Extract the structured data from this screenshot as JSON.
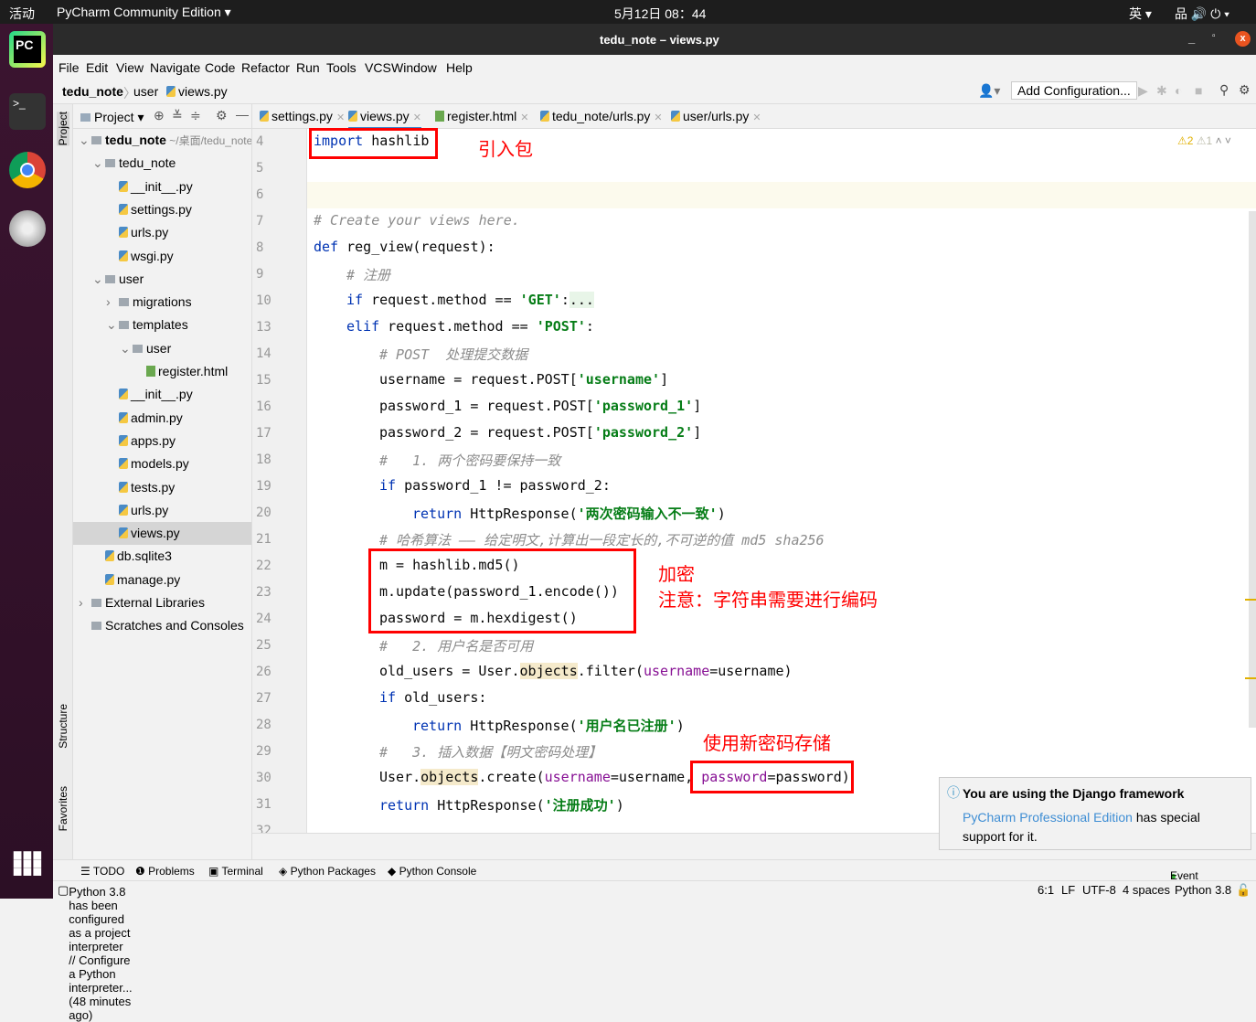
{
  "topbar": {
    "activities": "活动",
    "app": "PyCharm Community Edition ▾",
    "clock": "5月12日 08：44",
    "ime": "英 ▾",
    "tray": "品 🔊 ⏻ ▾"
  },
  "window": {
    "title": "tedu_note – views.py"
  },
  "menu": [
    "File",
    "Edit",
    "View",
    "Navigate",
    "Code",
    "Refactor",
    "Run",
    "Tools",
    "VCS",
    "Window",
    "Help"
  ],
  "breadcrumb": {
    "project": "tedu_note",
    "folder": "user",
    "file": "views.py"
  },
  "toolbar": {
    "add_configuration": "Add Configuration..."
  },
  "tabs": [
    {
      "label": "settings.py",
      "type": "py"
    },
    {
      "label": "views.py",
      "type": "py",
      "active": true
    },
    {
      "label": "register.html",
      "type": "html"
    },
    {
      "label": "tedu_note/urls.py",
      "type": "py"
    },
    {
      "label": "user/urls.py",
      "type": "py"
    }
  ],
  "sidestrip": {
    "project": "Project",
    "structure": "Structure",
    "favorites": "Favorites"
  },
  "project_panel": {
    "title": "Project ▾",
    "tree": [
      {
        "label": "tedu_note",
        "extra": " ~/桌面/tedu_note",
        "depth": 0,
        "kind": "folder",
        "arrow": "⌄",
        "bold": true
      },
      {
        "label": "tedu_note",
        "depth": 1,
        "kind": "folder",
        "arrow": "⌄"
      },
      {
        "label": "__init__.py",
        "depth": 2,
        "kind": "py"
      },
      {
        "label": "settings.py",
        "depth": 2,
        "kind": "py"
      },
      {
        "label": "urls.py",
        "depth": 2,
        "kind": "py"
      },
      {
        "label": "wsgi.py",
        "depth": 2,
        "kind": "py"
      },
      {
        "label": "user",
        "depth": 1,
        "kind": "folder",
        "arrow": "⌄"
      },
      {
        "label": "migrations",
        "depth": 2,
        "kind": "folder",
        "arrow": "›"
      },
      {
        "label": "templates",
        "depth": 2,
        "kind": "folder",
        "arrow": "⌄"
      },
      {
        "label": "user",
        "depth": 3,
        "kind": "folder",
        "arrow": "⌄"
      },
      {
        "label": "register.html",
        "depth": 4,
        "kind": "html"
      },
      {
        "label": "__init__.py",
        "depth": 2,
        "kind": "py"
      },
      {
        "label": "admin.py",
        "depth": 2,
        "kind": "py"
      },
      {
        "label": "apps.py",
        "depth": 2,
        "kind": "py"
      },
      {
        "label": "models.py",
        "depth": 2,
        "kind": "py"
      },
      {
        "label": "tests.py",
        "depth": 2,
        "kind": "py"
      },
      {
        "label": "urls.py",
        "depth": 2,
        "kind": "py"
      },
      {
        "label": "views.py",
        "depth": 2,
        "kind": "py",
        "selected": true
      },
      {
        "label": "db.sqlite3",
        "depth": 1,
        "kind": "py"
      },
      {
        "label": "manage.py",
        "depth": 1,
        "kind": "py"
      },
      {
        "label": "External Libraries",
        "depth": 0,
        "kind": "lib",
        "arrow": "›"
      },
      {
        "label": "Scratches and Consoles",
        "depth": 0,
        "kind": "lib"
      }
    ]
  },
  "editor": {
    "warnings": "⚠2",
    "weak_warnings": "⚠1",
    "lines": [
      {
        "n": "4",
        "i": 0,
        "t": [
          [
            "kw",
            "import"
          ],
          [
            "",
            "hashlib"
          ]
        ]
      },
      {
        "n": "5",
        "i": 0,
        "t": []
      },
      {
        "n": "6",
        "i": 0,
        "t": []
      },
      {
        "n": "7",
        "i": 0,
        "t": [
          [
            "cm",
            "# Create your views here."
          ]
        ]
      },
      {
        "n": "8",
        "i": 0,
        "t": [
          [
            "kw",
            "def"
          ],
          [
            "",
            " reg_view(request):"
          ]
        ]
      },
      {
        "n": "9",
        "i": 1,
        "t": [
          [
            "cm",
            "# 注册"
          ]
        ]
      },
      {
        "n": "10",
        "i": 1,
        "t": [
          [
            "kw",
            "if"
          ],
          [
            "",
            " request.method == "
          ],
          [
            "str",
            "'GET'"
          ],
          [
            "",
            ":"
          ],
          [
            "fold",
            "..."
          ]
        ]
      },
      {
        "n": "13",
        "i": 1,
        "t": [
          [
            "kw",
            "elif"
          ],
          [
            "",
            " request.method == "
          ],
          [
            "str",
            "'POST'"
          ],
          [
            "",
            ":"
          ]
        ]
      },
      {
        "n": "14",
        "i": 2,
        "t": [
          [
            "cm",
            "# POST  处理提交数据"
          ]
        ]
      },
      {
        "n": "15",
        "i": 2,
        "t": [
          [
            "",
            "username = request.POST["
          ],
          [
            "str",
            "'username'"
          ],
          [
            "",
            "]"
          ]
        ]
      },
      {
        "n": "16",
        "i": 2,
        "t": [
          [
            "",
            "password_1 = request.POST["
          ],
          [
            "str",
            "'password_1'"
          ],
          [
            "",
            "]"
          ]
        ]
      },
      {
        "n": "17",
        "i": 2,
        "t": [
          [
            "",
            "password_2 = request.POST["
          ],
          [
            "str",
            "'password_2'"
          ],
          [
            "",
            "]"
          ]
        ]
      },
      {
        "n": "18",
        "i": 2,
        "t": [
          [
            "cm",
            "#   1. 两个密码要保持一致"
          ]
        ]
      },
      {
        "n": "19",
        "i": 2,
        "t": [
          [
            "kw",
            "if"
          ],
          [
            "",
            " password_1 != password_2:"
          ]
        ]
      },
      {
        "n": "20",
        "i": 3,
        "t": [
          [
            "kw",
            "return"
          ],
          [
            "",
            " HttpResponse("
          ],
          [
            "str",
            "'两次密码输入不一致'"
          ],
          [
            "",
            ")"
          ]
        ]
      },
      {
        "n": "21",
        "i": 2,
        "t": [
          [
            "cm",
            "# 哈希算法 —— 给定明文,计算出一段定长的,不可逆的值 md5 sha256"
          ]
        ]
      },
      {
        "n": "22",
        "i": 2,
        "t": [
          [
            "",
            "m = hashlib.md5()"
          ]
        ]
      },
      {
        "n": "23",
        "i": 2,
        "t": [
          [
            "",
            "m.update(password_1.encode())"
          ]
        ]
      },
      {
        "n": "24",
        "i": 2,
        "t": [
          [
            "",
            "password = m.hexdigest()"
          ]
        ]
      },
      {
        "n": "25",
        "i": 2,
        "t": [
          [
            "cm",
            "#   2. 用户名是否可用"
          ]
        ]
      },
      {
        "n": "26",
        "i": 2,
        "t": [
          [
            "",
            "old_users = User."
          ],
          [
            "hl",
            "objects"
          ],
          [
            "",
            ".filter("
          ],
          [
            "kwarg",
            "username"
          ],
          [
            "",
            "=username)"
          ]
        ]
      },
      {
        "n": "27",
        "i": 2,
        "t": [
          [
            "kw",
            "if"
          ],
          [
            "",
            " old_users:"
          ]
        ]
      },
      {
        "n": "28",
        "i": 3,
        "t": [
          [
            "kw",
            "return"
          ],
          [
            "",
            " HttpResponse("
          ],
          [
            "str",
            "'用户名已注册'"
          ],
          [
            "",
            ")"
          ]
        ]
      },
      {
        "n": "29",
        "i": 2,
        "t": [
          [
            "cm",
            "#   3. 插入数据【明文密码处理】"
          ]
        ]
      },
      {
        "n": "30",
        "i": 2,
        "t": [
          [
            "",
            "User."
          ],
          [
            "hl",
            "objects"
          ],
          [
            "",
            ".create("
          ],
          [
            "kwarg",
            "username"
          ],
          [
            "",
            "=username, "
          ],
          [
            "kwarg",
            "password"
          ],
          [
            "",
            "=password)"
          ]
        ]
      },
      {
        "n": "31",
        "i": 2,
        "t": [
          [
            "kw",
            "return"
          ],
          [
            "",
            " HttpResponse("
          ],
          [
            "str",
            "'注册成功'"
          ],
          [
            "",
            ")"
          ]
        ]
      },
      {
        "n": "32",
        "i": 0,
        "t": []
      }
    ]
  },
  "annotations": {
    "import_note": "引入包",
    "encrypt_note": "加密",
    "encode_note": "注意：字符串需要进行编码",
    "store_note": "使用新密码存储"
  },
  "notification": {
    "title": "You are using the Django framework",
    "link": "PyCharm Professional Edition",
    "text": " has special support for it."
  },
  "bottom_tools": [
    "☰ TODO",
    "❶ Problems",
    "▣ Terminal",
    "◈ Python Packages",
    "◆ Python Console"
  ],
  "event_log": "Event Log",
  "status": {
    "message": "Python 3.8 has been configured as a project interpreter // Configure a Python interpreter... (48 minutes ago)",
    "position": "6:1",
    "line_sep": "LF",
    "encoding": "UTF-8",
    "indent": "4 spaces",
    "interpreter": "Python 3.8"
  },
  "colors": {
    "accent": "#4083c9",
    "annotation": "#ff0000",
    "keyword": "#0033b3",
    "string": "#067d17",
    "comment": "#8c8c8c"
  }
}
